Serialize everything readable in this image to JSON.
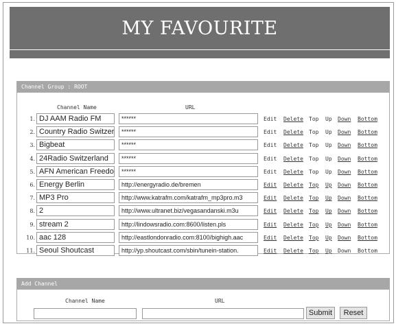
{
  "title": "MY FAVOURITE",
  "group_panel": {
    "header": "Channel Group : ROOT",
    "col_name": "Channel Name",
    "col_url": "URL",
    "actions": {
      "edit": "Edit",
      "delete": "Delete",
      "top": "Top",
      "up": "Up",
      "down": "Down",
      "bottom": "Bottom"
    },
    "rows": [
      {
        "num": "1.",
        "name": "DJ AAM Radio FM",
        "url": "******"
      },
      {
        "num": "2.",
        "name": "Country Radio Switzerlar",
        "url": "******"
      },
      {
        "num": "3.",
        "name": "Bigbeat",
        "url": "******"
      },
      {
        "num": "4.",
        "name": "24Radio Switzerland",
        "url": "******"
      },
      {
        "num": "5.",
        "name": "AFN American Freedom",
        "url": "******"
      },
      {
        "num": "6.",
        "name": "Energy Berlin",
        "url": "http://energyradio.de/bremen"
      },
      {
        "num": "7.",
        "name": "MP3 Pro",
        "url": "http://www.katrafm.com/katrafm_mp3pro.m3"
      },
      {
        "num": "8.",
        "name": "2",
        "url": "http://www.ultranet.biz/vegasandanski.m3u"
      },
      {
        "num": "9.",
        "name": "stream 2",
        "url": "http://lindowsradio.com:8600/listen.pls"
      },
      {
        "num": "10.",
        "name": "aac 128",
        "url": "http://eastlondonradio.com:8100/bighigh.aac"
      },
      {
        "num": "11.",
        "name": "Seoul Shoutcast",
        "url": "http://yp.shoutcast.com/sbin/tunein-station."
      }
    ]
  },
  "add_panel": {
    "header": "Add Channel",
    "name_label": "Channel Name",
    "url_label": "URL",
    "name_value": "",
    "url_value": "",
    "submit": "Submit",
    "reset": "Reset"
  }
}
